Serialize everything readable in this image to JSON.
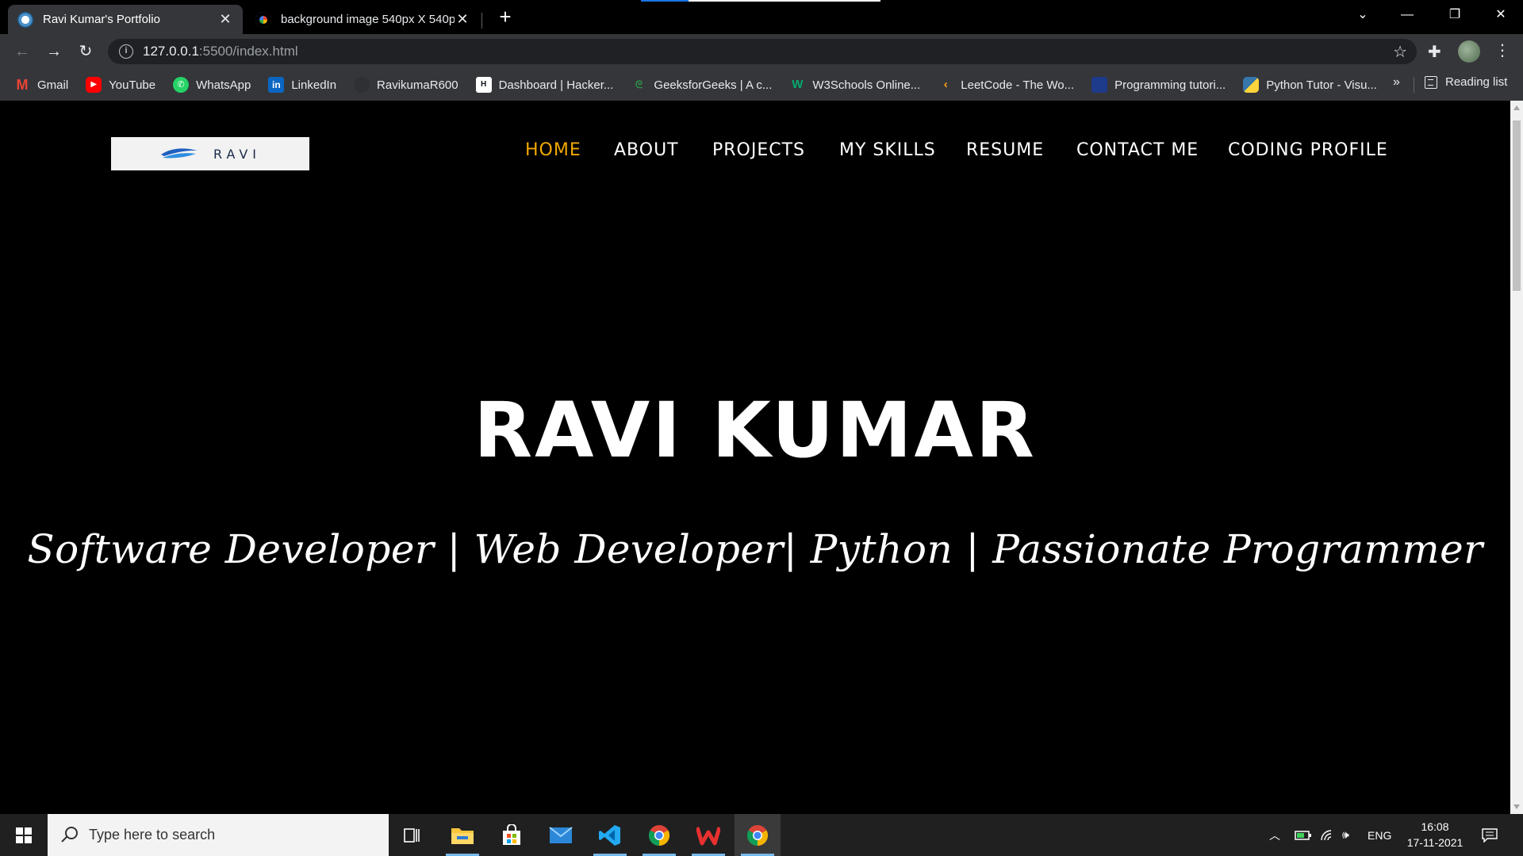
{
  "browser": {
    "tabs": [
      {
        "title": "Ravi Kumar's Portfolio",
        "active": true
      },
      {
        "title": "background image 540px X 540px",
        "active": false
      }
    ],
    "url_host": "127.0.0.1",
    "url_path": ":5500/index.html",
    "bookmarks": [
      {
        "label": "Gmail",
        "icon": "gmail-icon",
        "color": "#ea4335"
      },
      {
        "label": "YouTube",
        "icon": "youtube-icon",
        "color": "#ff0000"
      },
      {
        "label": "WhatsApp",
        "icon": "whatsapp-icon",
        "color": "#25d366"
      },
      {
        "label": "LinkedIn",
        "icon": "linkedin-icon",
        "color": "#0a66c2"
      },
      {
        "label": "RavikumaR600",
        "icon": "github-icon",
        "color": "#24292e"
      },
      {
        "label": "Dashboard | Hacker...",
        "icon": "hackerrank-icon",
        "color": "#0e141e"
      },
      {
        "label": "GeeksforGeeks | A c...",
        "icon": "geeksforgeeks-icon",
        "color": "#2f8d46"
      },
      {
        "label": "W3Schools Online...",
        "icon": "w3schools-icon",
        "color": "#04aa6d"
      },
      {
        "label": "LeetCode - The Wo...",
        "icon": "leetcode-icon",
        "color": "#ffa116"
      },
      {
        "label": "Programming tutori...",
        "icon": "programiz-icon",
        "color": "#1e3a8a"
      },
      {
        "label": "Python Tutor - Visu...",
        "icon": "python-icon",
        "color": "#3776ab"
      }
    ],
    "bookmarks_more": "»",
    "reading_list": "Reading list"
  },
  "site": {
    "logo_text": "RAVI",
    "nav": [
      {
        "label": "HOME",
        "active": true
      },
      {
        "label": "ABOUT",
        "active": false
      },
      {
        "label": "PROJECTS",
        "active": false
      },
      {
        "label": "MY SKILLS",
        "active": false
      },
      {
        "label": "RESUME",
        "active": false
      },
      {
        "label": "CONTACT ME",
        "active": false
      },
      {
        "label": "CODING PROFILE",
        "active": false
      }
    ],
    "hero_name": "RAVI KUMAR",
    "hero_tagline": "Software Developer | Web Developer| Python | Passionate Programmer",
    "accent_color": "#f2a900"
  },
  "taskbar": {
    "search_placeholder": "Type here to search",
    "apps": [
      "task-view-icon",
      "file-explorer-icon",
      "microsoft-store-icon",
      "mail-icon",
      "vscode-icon",
      "chrome-icon",
      "wps-office-icon",
      "chrome-icon"
    ],
    "language": "ENG",
    "time": "16:08",
    "date": "17-11-2021"
  }
}
